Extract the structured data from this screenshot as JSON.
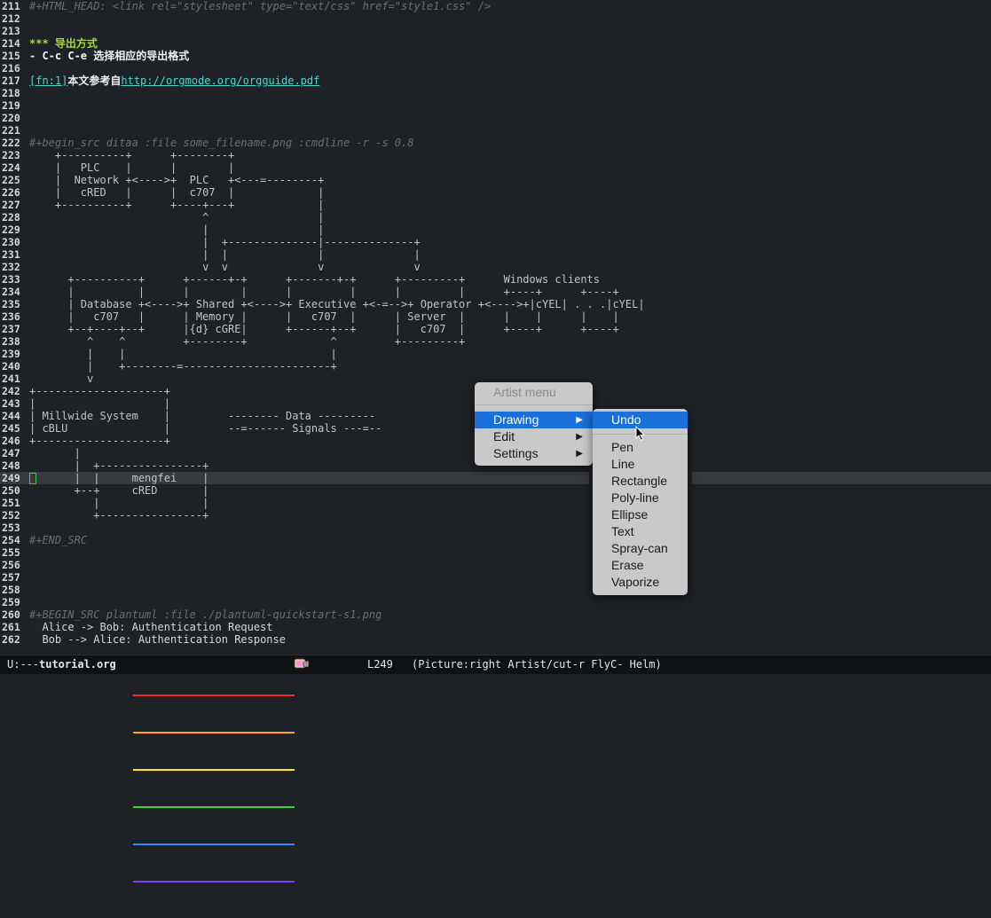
{
  "editor": {
    "lines": [
      {
        "num": "211",
        "text": "#+HTML_HEAD: <link rel=\"stylesheet\" type=\"text/css\" href=\"style1.css\" />",
        "style": "comment"
      },
      {
        "num": "212",
        "text": "",
        "style": "plain"
      },
      {
        "num": "213",
        "text": "",
        "style": "plain"
      },
      {
        "num": "214",
        "text": "*** 导出方式",
        "style": "head"
      },
      {
        "num": "215",
        "text": "- C-c C-e 选择相应的导出格式",
        "style": "bold"
      },
      {
        "num": "216",
        "text": "",
        "style": "plain"
      },
      {
        "num": "217",
        "text": "",
        "style": "footnote",
        "fn": "[fn:1]",
        "mid": "本文参考自",
        "link": "http://orgmode.org/orgguide.pdf"
      },
      {
        "num": "218",
        "text": "",
        "style": "plain"
      },
      {
        "num": "219",
        "text": "",
        "style": "plain"
      },
      {
        "num": "220",
        "text": "",
        "style": "plain"
      },
      {
        "num": "221",
        "text": "",
        "style": "plain"
      },
      {
        "num": "222",
        "text": "#+begin_src ditaa :file some_filename.png :cmdline -r -s 0.8",
        "style": "comment"
      },
      {
        "num": "223",
        "text": "    +----------+      +--------+",
        "style": "ascii"
      },
      {
        "num": "224",
        "text": "    |   PLC    |      |        |",
        "style": "ascii"
      },
      {
        "num": "225",
        "text": "    |  Network +<---->+  PLC   +<---=--------+",
        "style": "ascii"
      },
      {
        "num": "226",
        "text": "    |   cRED   |      |  c707  |             |",
        "style": "ascii"
      },
      {
        "num": "227",
        "text": "    +----------+      +----+---+             |",
        "style": "ascii"
      },
      {
        "num": "228",
        "text": "                           ^                 |",
        "style": "ascii"
      },
      {
        "num": "229",
        "text": "                           |                 |",
        "style": "ascii"
      },
      {
        "num": "230",
        "text": "                           |  +--------------|--------------+",
        "style": "ascii"
      },
      {
        "num": "231",
        "text": "                           |  |              |              |",
        "style": "ascii"
      },
      {
        "num": "232",
        "text": "                           v  v              v              v",
        "style": "ascii"
      },
      {
        "num": "233",
        "text": "      +----------+      +------+-+      +-------+-+      +---------+      Windows clients",
        "style": "ascii"
      },
      {
        "num": "234",
        "text": "      |          |      |        |      |         |      |         |      +----+      +----+",
        "style": "ascii"
      },
      {
        "num": "235",
        "text": "      | Database +<---->+ Shared +<---->+ Executive +<-=-->+ Operator +<---->+|cYEL| . . .|cYEL|",
        "style": "ascii"
      },
      {
        "num": "236",
        "text": "      |   c707   |      | Memory |      |   c707  |      | Server  |      |    |      |    |",
        "style": "ascii"
      },
      {
        "num": "237",
        "text": "      +--+----+--+      |{d} cGRE|      +------+--+      |   c707  |      +----+      +----+",
        "style": "ascii"
      },
      {
        "num": "238",
        "text": "         ^    ^         +--------+             ^         +---------+",
        "style": "ascii"
      },
      {
        "num": "239",
        "text": "         |    |                                |",
        "style": "ascii"
      },
      {
        "num": "240",
        "text": "         |    +--------=-----------------------+",
        "style": "ascii"
      },
      {
        "num": "241",
        "text": "         v",
        "style": "ascii"
      },
      {
        "num": "242",
        "text": "+--------------------+",
        "style": "ascii"
      },
      {
        "num": "243",
        "text": "|                    |",
        "style": "ascii"
      },
      {
        "num": "244",
        "text": "| Millwide System    |         -------- Data ---------",
        "style": "ascii"
      },
      {
        "num": "245",
        "text": "| cBLU               |         --=------ Signals ---=--",
        "style": "ascii"
      },
      {
        "num": "246",
        "text": "+--------------------+",
        "style": "ascii"
      },
      {
        "num": "247",
        "text": "       |",
        "style": "ascii"
      },
      {
        "num": "248",
        "text": "       |  +----------------+",
        "style": "ascii"
      },
      {
        "num": "249",
        "text": "       |  |     mengfei    |",
        "style": "ascii"
      },
      {
        "num": "250",
        "text": "       +--+     cRED       |",
        "style": "ascii"
      },
      {
        "num": "251",
        "text": "          |                |",
        "style": "ascii"
      },
      {
        "num": "252",
        "text": "          +----------------+",
        "style": "ascii"
      },
      {
        "num": "253",
        "text": "",
        "style": "plain"
      },
      {
        "num": "254",
        "text": "#+END_SRC",
        "style": "comment"
      },
      {
        "num": "255",
        "text": "",
        "style": "plain"
      },
      {
        "num": "256",
        "text": "",
        "style": "plain"
      },
      {
        "num": "257",
        "text": "",
        "style": "plain"
      },
      {
        "num": "258",
        "text": "",
        "style": "plain"
      },
      {
        "num": "259",
        "text": "",
        "style": "plain"
      },
      {
        "num": "260",
        "text": "#+BEGIN_SRC plantuml :file ./plantuml-quickstart-s1.png",
        "style": "comment"
      },
      {
        "num": "261",
        "text": "  Alice -> Bob: Authentication Request",
        "style": "src"
      },
      {
        "num": "262",
        "text": "  Bob --> Alice: Authentication Response",
        "style": "src"
      }
    ],
    "current_line_index": 38
  },
  "artist_menu": {
    "title": "Artist menu",
    "items": [
      {
        "label": "Drawing",
        "arrow": "▶",
        "selected": true
      },
      {
        "label": "Edit",
        "arrow": "▶",
        "selected": false
      },
      {
        "label": "Settings",
        "arrow": "▶",
        "selected": false
      }
    ]
  },
  "drawing_submenu": {
    "undo": "Undo",
    "items": [
      "Pen",
      "Line",
      "Rectangle",
      "Poly-line",
      "Ellipse",
      "Text",
      "Spray-can",
      "Erase",
      "Vaporize"
    ]
  },
  "modeline": {
    "state": "U:---",
    "buffer": "tutorial.org",
    "line": "L249",
    "modes": "(Picture:right Artist/cut-r FlyC- Helm)"
  },
  "colors": {
    "background": "#1e2125",
    "selection": "#1a6fd8",
    "heading": "#a6d934",
    "link": "#4ed6d2",
    "comment": "#6b6e72"
  },
  "icons": {
    "mouse_pointer": "arrow-cursor-icon",
    "progress_indicator": "nyan-cat-icon"
  }
}
